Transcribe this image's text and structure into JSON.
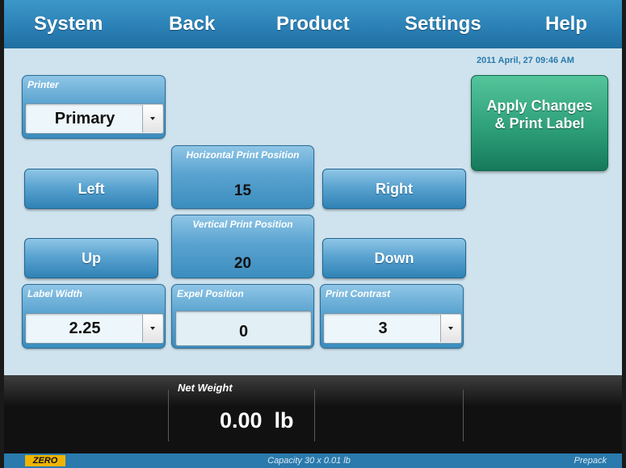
{
  "menu": {
    "system": "System",
    "back": "Back",
    "product": "Product",
    "settings": "Settings",
    "help": "Help"
  },
  "datetime": "2011 April, 27 09:46 AM",
  "printer": {
    "label": "Printer",
    "value": "Primary"
  },
  "horizontal": {
    "label": "Horizontal Print Position",
    "value": "15"
  },
  "vertical": {
    "label": "Vertical Print Position",
    "value": "20"
  },
  "buttons": {
    "left": "Left",
    "right": "Right",
    "up": "Up",
    "down": "Down"
  },
  "label_width": {
    "label": "Label Width",
    "value": "2.25"
  },
  "expel": {
    "label": "Expel Position",
    "value": "0"
  },
  "contrast": {
    "label": "Print Contrast",
    "value": "3"
  },
  "apply": {
    "line1": "Apply Changes",
    "line2": "& Print Label"
  },
  "net_weight": {
    "label": "Net Weight",
    "value": "0.00  lb"
  },
  "status": {
    "zero": "ZERO",
    "capacity": "Capacity 30 x 0.01 lb",
    "mode": "Prepack"
  },
  "colors": {
    "menu_bar": "#2a7fb4",
    "panel": "#5aa3d0",
    "apply": "#2ea07a",
    "background": "#cfe3ee",
    "zero_badge": "#f0b400"
  },
  "icons": {
    "dropdown": "dropdown-arrow-icon"
  }
}
